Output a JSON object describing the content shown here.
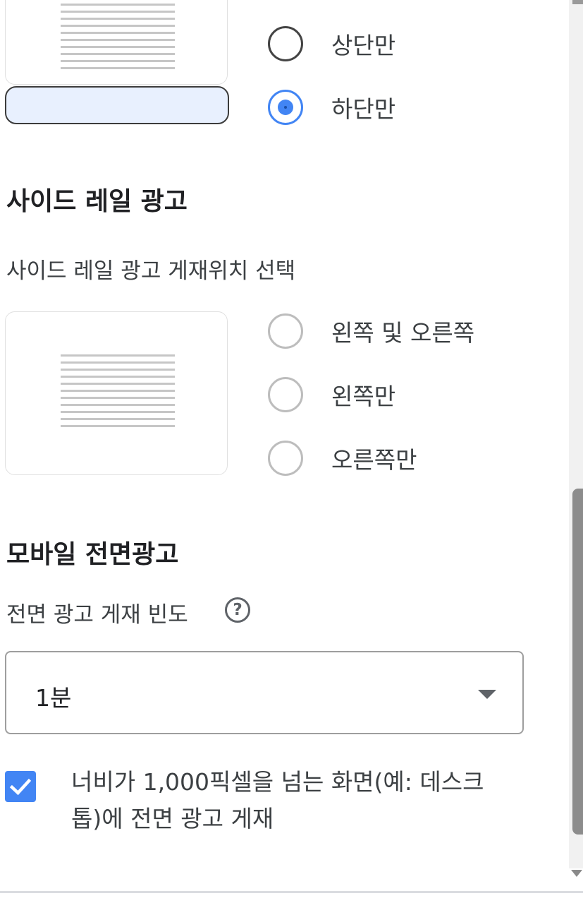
{
  "anchor_ads": {
    "options": [
      {
        "label": "상단만",
        "selected": false
      },
      {
        "label": "하단만",
        "selected": true
      }
    ]
  },
  "side_rail": {
    "title": "사이드 레일 광고",
    "subtitle": "사이드 레일 광고 게재위치 선택",
    "options": [
      {
        "label": "왼쪽 및 오른쪽",
        "selected": false
      },
      {
        "label": "왼쪽만",
        "selected": false
      },
      {
        "label": "오른쪽만",
        "selected": false
      }
    ]
  },
  "vignette": {
    "title": "모바일 전면광고",
    "frequency_label": "전면 광고 게재 빈도",
    "help_icon": "help-circle-icon",
    "frequency_value": "1분",
    "desktop_checkbox": {
      "label": "너비가 1,000픽셀을 넘는 화면(예: 데스크톱)에 전면 광고 게재",
      "checked": true
    }
  },
  "colors": {
    "accent": "#4285f4",
    "anchor_highlight": "#e8f0fe"
  }
}
